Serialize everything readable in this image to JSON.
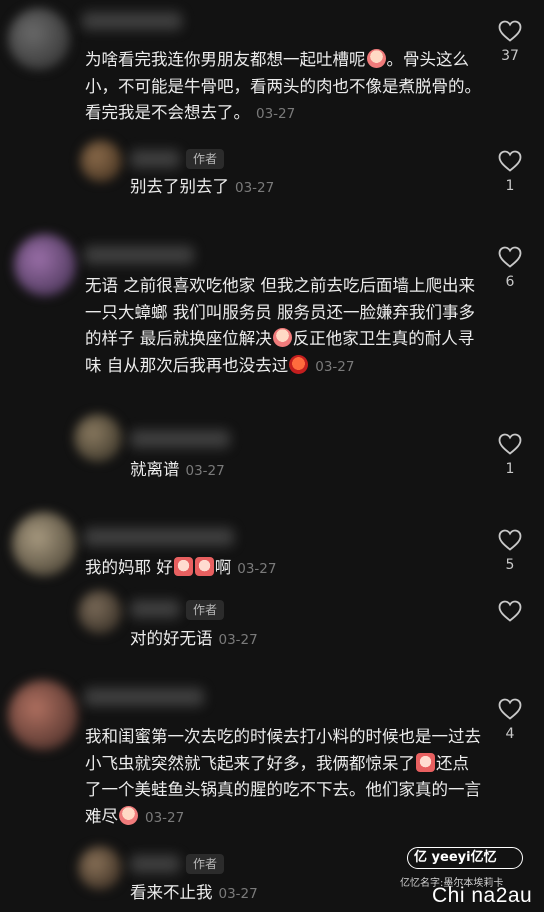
{
  "comments": [
    {
      "text_a": "为啥看完我连你男朋友都想一起吐槽呢",
      "text_b": "。骨头这么小，不可能是牛骨吧，看两头的肉也不像是煮脱骨的。看完我是不会想去了。",
      "emoji": "sob-emoji",
      "time": "03-27",
      "likes": "37",
      "reply": {
        "author_tag": "作者",
        "text": "别去了别去了",
        "time": "03-27",
        "likes": "1"
      }
    },
    {
      "text_a": "无语 之前很喜欢吃他家 但我之前去吃后面墙上爬出来一只大蟑螂 我们叫服务员 服务员还一脸嫌弃我们事多的样子 最后就换座位解决",
      "text_b": "反正他家卫生真的耐人寻味 自从那次后我再也没去过",
      "emoji": "sob-emoji",
      "emoji2": "angry-emoji",
      "time": "03-27",
      "likes": "6",
      "reply": {
        "text": "就离谱",
        "time": "03-27",
        "likes": "1"
      }
    },
    {
      "text_a": "我的妈耶 好",
      "text_b": "啊",
      "emoji": "sob-emoji",
      "time": "03-27",
      "likes": "5",
      "reply": {
        "author_tag": "作者",
        "text": "对的好无语",
        "time": "03-27"
      }
    },
    {
      "text_a": "我和闺蜜第一次去吃的时候去打小料的时候也是一过去小飞虫就突然就飞起来了好多，我俩都惊呆了",
      "text_b": "还点了一个美蛙鱼头锅真的腥的吃不下去。他们家真的一言难尽",
      "emoji": "sob-emoji",
      "time": "03-27",
      "likes": "4",
      "reply": {
        "author_tag": "作者",
        "text": "看来不止我",
        "time": "03-27"
      }
    }
  ],
  "watermark": {
    "badge": "亿 yeeyi亿忆",
    "sub": "亿忆名字:墨尔本埃莉卡",
    "site": "Chi na2au"
  },
  "colors": {
    "background": "#121212",
    "text": "#ececec",
    "muted": "#7a7a7a",
    "tag_bg": "#2b2b2b"
  }
}
